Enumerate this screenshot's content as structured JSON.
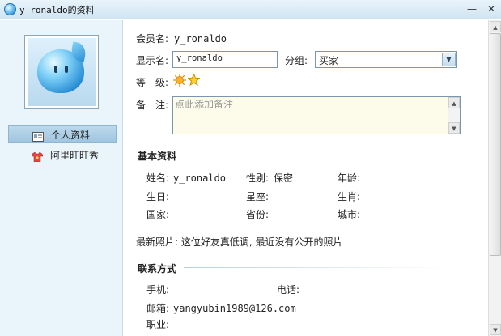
{
  "window": {
    "title": "y_ronaldo的资料",
    "minimize_glyph": "—",
    "close_glyph": "✕"
  },
  "sidebar": {
    "items": [
      {
        "label": "个人资料",
        "icon": "id-card-icon",
        "active": true
      },
      {
        "label": "阿里旺旺秀",
        "icon": "shirt-icon",
        "active": false
      }
    ]
  },
  "profile": {
    "member_label": "会员名:",
    "member_value": "y_ronaldo",
    "display_label": "显示名:",
    "display_value": "y_ronaldo",
    "group_label": "分组:",
    "group_value": "买家",
    "level_label": "等　级:",
    "note_label": "备　注:",
    "note_placeholder": "点此添加备注"
  },
  "basic": {
    "title": "基本资料",
    "name_label": "姓名:",
    "name_value": "y_ronaldo",
    "gender_label": "性别:",
    "gender_value": "保密",
    "age_label": "年龄:",
    "birthday_label": "生日:",
    "constellation_label": "星座:",
    "zodiac_label": "生肖:",
    "country_label": "国家:",
    "province_label": "省份:",
    "city_label": "城市:",
    "photo_text": "最新照片: 这位好友真低调, 最近没有公开的照片"
  },
  "contact": {
    "title": "联系方式",
    "mobile_label": "手机:",
    "phone_label": "电话:",
    "email_label": "邮箱:",
    "email_value": "yangyubin1989@126.com",
    "job_label": "职业:"
  },
  "colors": {
    "accent": "#9fc5df",
    "sidebar_bg": "#eaf4fb",
    "note_bg": "#fdfbea"
  }
}
